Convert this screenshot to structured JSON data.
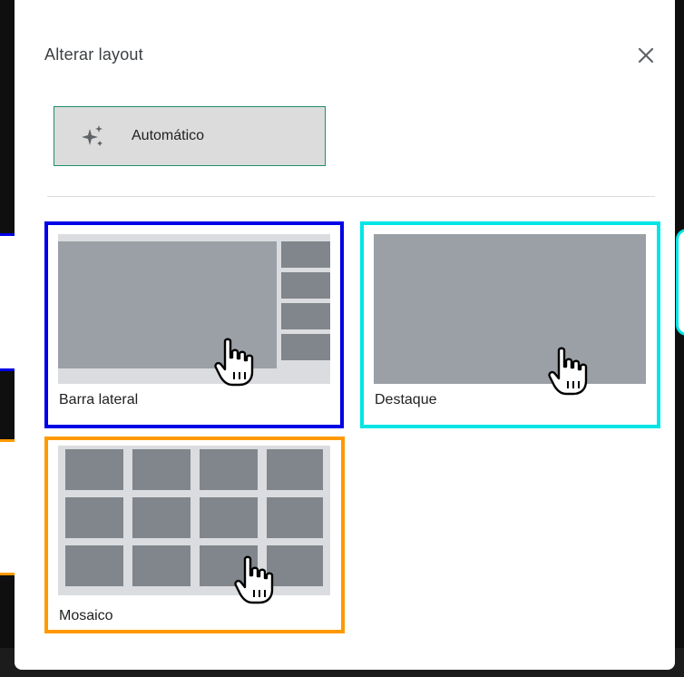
{
  "dialog": {
    "title": "Alterar layout",
    "close_icon": "close-icon",
    "auto_button": {
      "label": "Automático",
      "icon": "sparkle-icon"
    }
  },
  "layouts": [
    {
      "id": "sidebar",
      "label": "Barra lateral",
      "highlight_color": "#0000e6"
    },
    {
      "id": "spotlight",
      "label": "Destaque",
      "highlight_color": "#00e5e5"
    },
    {
      "id": "tiled",
      "label": "Mosaico",
      "highlight_color": "#ff9900"
    }
  ],
  "colors": {
    "tile_frame": "#dadce0",
    "tile_block": "#80868b",
    "auto_button_border": "#1e8e6e",
    "auto_button_bg": "#dcdcdc"
  }
}
